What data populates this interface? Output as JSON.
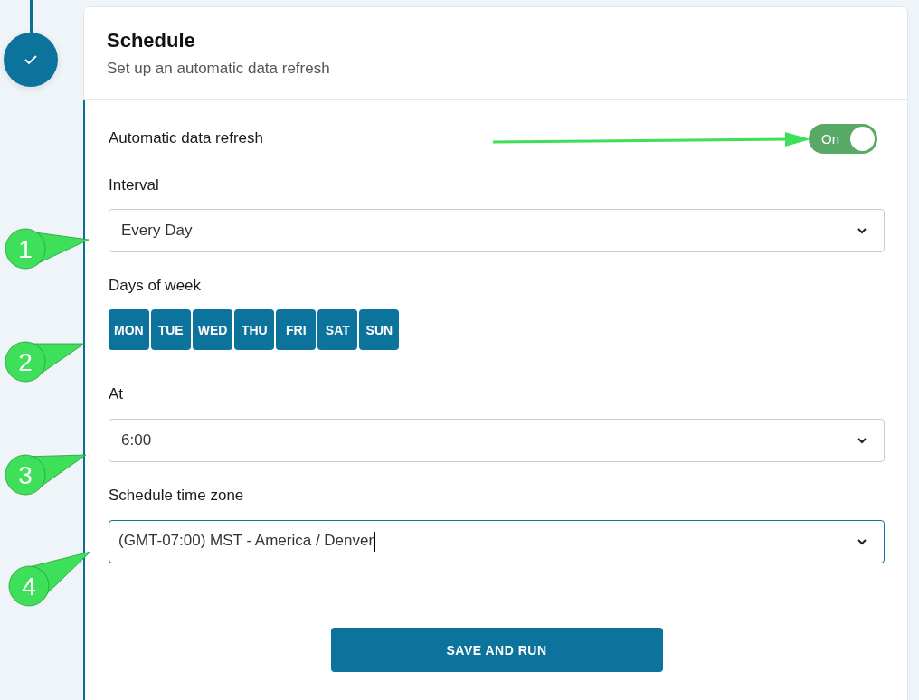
{
  "step": {
    "completed": true
  },
  "header": {
    "title": "Schedule",
    "subtitle": "Set up an automatic data refresh"
  },
  "auto_refresh": {
    "label": "Automatic data refresh",
    "toggle_label": "On",
    "on": true
  },
  "interval": {
    "label": "Interval",
    "value": "Every Day",
    "focused": false
  },
  "days_of_week": {
    "label": "Days of week",
    "days": [
      {
        "label": "MON",
        "selected": true
      },
      {
        "label": "TUE",
        "selected": true
      },
      {
        "label": "WED",
        "selected": true
      },
      {
        "label": "THU",
        "selected": true
      },
      {
        "label": "FRI",
        "selected": true
      },
      {
        "label": "SAT",
        "selected": true
      },
      {
        "label": "SUN",
        "selected": true
      }
    ]
  },
  "at": {
    "label": "At",
    "value": "6:00",
    "focused": false
  },
  "time_zone": {
    "label": "Schedule time zone",
    "value": "(GMT-07:00) MST - America / Denver",
    "focused": true
  },
  "save_button": "SAVE AND RUN",
  "callouts": [
    {
      "label": "1"
    },
    {
      "label": "2"
    },
    {
      "label": "3"
    },
    {
      "label": "4"
    }
  ]
}
